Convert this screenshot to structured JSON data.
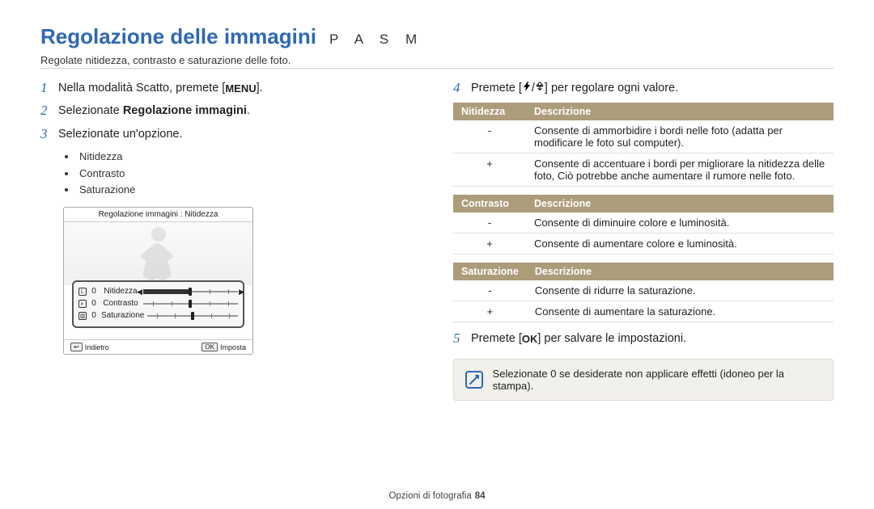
{
  "header": {
    "title": "Regolazione delle immagini",
    "modes": "P A S M",
    "subtitle": "Regolate nitidezza, contrasto e saturazione delle foto."
  },
  "left": {
    "step1_a": "Nella modalità Scatto, premete [",
    "step1_menu": "MENU",
    "step1_b": "].",
    "step2_a": "Selezionate ",
    "step2_bold": "Regolazione immagini",
    "step2_b": ".",
    "step3": "Selezionate un'opzione.",
    "bullets": [
      "Nitidezza",
      "Contrasto",
      "Saturazione"
    ]
  },
  "camera": {
    "titlebar": "Regolazione immagini : Nitidezza",
    "rows": [
      {
        "icon": "L",
        "val": "0",
        "label": "Nitidezza"
      },
      {
        "icon": "◐",
        "val": "0",
        "label": "Contrasto"
      },
      {
        "icon": "▥",
        "val": "0",
        "label": "Saturazione"
      }
    ],
    "footer_back_key": "↩",
    "footer_back": "Indietro",
    "footer_set_key": "OK",
    "footer_set": "Imposta"
  },
  "right": {
    "step4_a": "Premete [",
    "step4_sep": "/",
    "step4_b": "] per regolare ogni valore.",
    "step5_a": "Premete [",
    "step5_ok": "OK",
    "step5_b": "] per salvare le impostazioni.",
    "note": "Selezionate 0 se desiderate non applicare effetti (idoneo per la stampa).",
    "tables": {
      "nitidezza": {
        "th1": "Nitidezza",
        "th2": "Descrizione",
        "rows": [
          {
            "k": "-",
            "v": "Consente di ammorbidire i bordi nelle foto (adatta per modificare le foto sul computer)."
          },
          {
            "k": "+",
            "v": "Consente di accentuare i bordi per migliorare la nitidezza delle foto, Ciò potrebbe anche aumentare il rumore nelle foto."
          }
        ]
      },
      "contrasto": {
        "th1": "Contrasto",
        "th2": "Descrizione",
        "rows": [
          {
            "k": "-",
            "v": "Consente di diminuire colore e luminosità."
          },
          {
            "k": "+",
            "v": "Consente di aumentare colore e luminosità."
          }
        ]
      },
      "saturazione": {
        "th1": "Saturazione",
        "th2": "Descrizione",
        "rows": [
          {
            "k": "-",
            "v": "Consente di ridurre la saturazione."
          },
          {
            "k": "+",
            "v": "Consente di aumentare la saturazione."
          }
        ]
      }
    }
  },
  "footer": {
    "section": "Opzioni di fotografia",
    "page": "84"
  }
}
